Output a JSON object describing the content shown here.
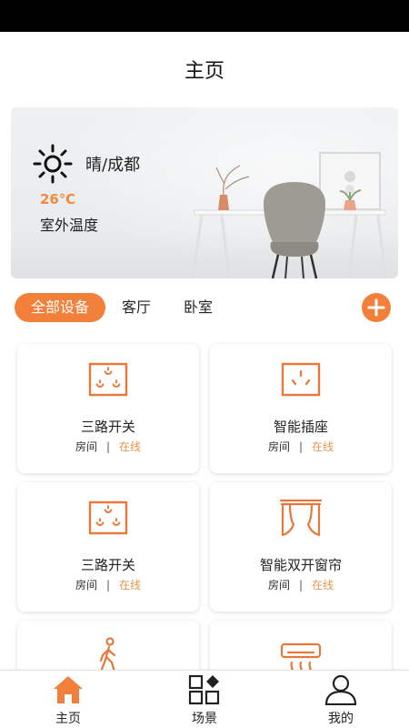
{
  "page_title": "主页",
  "weather": {
    "icon": "sun-icon",
    "condition_city": "晴/成都",
    "temperature": "26℃",
    "temperature_label": "室外温度"
  },
  "tabs": [
    {
      "label": "全部设备",
      "active": true
    },
    {
      "label": "客厅",
      "active": false
    },
    {
      "label": "卧室",
      "active": false
    }
  ],
  "devices": [
    {
      "name": "三路开关",
      "room": "房间",
      "separator": "|",
      "status": "在线",
      "icon": "three-way-switch-icon"
    },
    {
      "name": "智能插座",
      "room": "房间",
      "separator": "|",
      "status": "在线",
      "icon": "smart-socket-icon"
    },
    {
      "name": "三路开关",
      "room": "房间",
      "separator": "|",
      "status": "在线",
      "icon": "three-way-switch-icon"
    },
    {
      "name": "智能双开窗帘",
      "room": "房间",
      "separator": "|",
      "status": "在线",
      "icon": "curtain-icon"
    },
    {
      "icon": "motion-sensor-icon"
    },
    {
      "icon": "air-conditioner-icon"
    }
  ],
  "bottom_nav": [
    {
      "label": "主页",
      "icon": "home-icon",
      "active": true
    },
    {
      "label": "场景",
      "icon": "scene-icon",
      "active": false
    },
    {
      "label": "我的",
      "icon": "profile-icon",
      "active": false
    }
  ],
  "colors": {
    "accent": "#f3803a",
    "online": "#e6954d",
    "temperature": "#f08a3c"
  }
}
